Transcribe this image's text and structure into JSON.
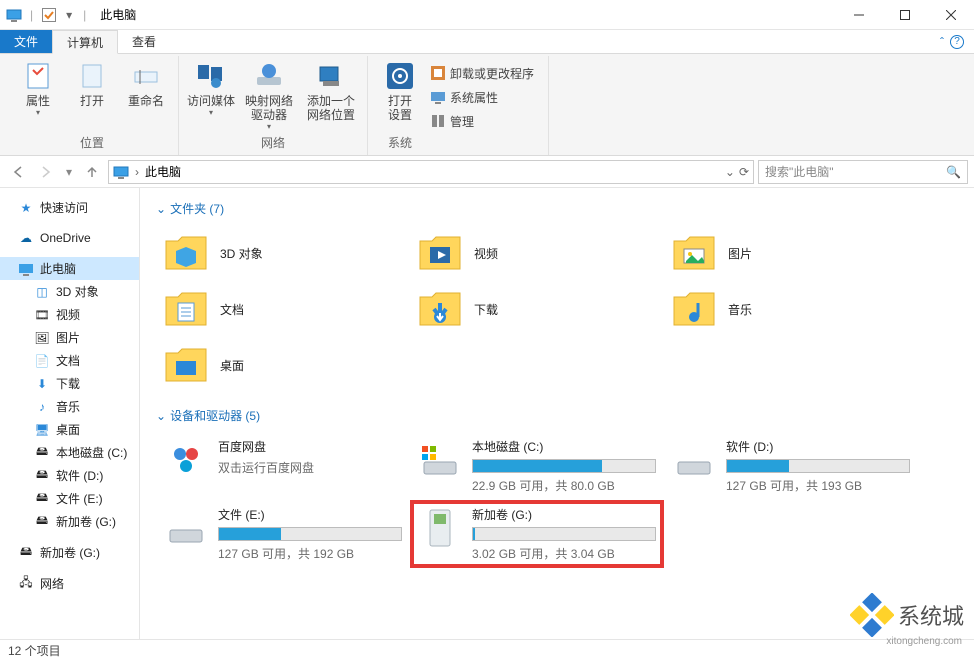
{
  "titlebar": {
    "title": "此电脑",
    "sep": "|"
  },
  "tabs": {
    "file": "文件",
    "computer": "计算机",
    "view": "查看"
  },
  "ribbon": {
    "location": {
      "properties": "属性",
      "open": "打开",
      "rename": "重命名",
      "group": "位置"
    },
    "network": {
      "access_media": "访问媒体",
      "map_drive": "映射网络\n驱动器",
      "add_loc": "添加一个\n网络位置",
      "group": "网络"
    },
    "system": {
      "open_settings": "打开\n设置",
      "uninstall": "卸载或更改程序",
      "sys_props": "系统属性",
      "manage": "管理",
      "group": "系统"
    }
  },
  "address": {
    "path": "此电脑",
    "search_placeholder": "搜索\"此电脑\""
  },
  "sidebar": {
    "quick": "快速访问",
    "onedrive": "OneDrive",
    "thispc": "此电脑",
    "children": [
      {
        "label": "3D 对象"
      },
      {
        "label": "视频"
      },
      {
        "label": "图片"
      },
      {
        "label": "文档"
      },
      {
        "label": "下载"
      },
      {
        "label": "音乐"
      },
      {
        "label": "桌面"
      },
      {
        "label": "本地磁盘 (C:)"
      },
      {
        "label": "软件 (D:)"
      },
      {
        "label": "文件 (E:)"
      },
      {
        "label": "新加卷 (G:)"
      },
      {
        "label": "新加卷 (G:)"
      }
    ],
    "network": "网络"
  },
  "sections": {
    "folders": {
      "head": "文件夹 (7)",
      "items": [
        {
          "label": "3D 对象"
        },
        {
          "label": "视频"
        },
        {
          "label": "图片"
        },
        {
          "label": "文档"
        },
        {
          "label": "下载"
        },
        {
          "label": "音乐"
        },
        {
          "label": "桌面"
        }
      ]
    },
    "drives": {
      "head": "设备和驱动器 (5)",
      "items": [
        {
          "name": "百度网盘",
          "sub": "双击运行百度网盘",
          "bar": null
        },
        {
          "name": "本地磁盘 (C:)",
          "sub": "22.9 GB 可用，共 80.0 GB",
          "bar": 71
        },
        {
          "name": "软件 (D:)",
          "sub": "127 GB 可用，共 193 GB",
          "bar": 34
        },
        {
          "name": "文件 (E:)",
          "sub": "127 GB 可用，共 192 GB",
          "bar": 34
        },
        {
          "name": "新加卷 (G:)",
          "sub": "3.02 GB 可用，共 3.04 GB",
          "bar": 1,
          "highlight": true
        }
      ]
    }
  },
  "status": {
    "items": "12 个项目"
  },
  "watermark": {
    "brand": "系统城",
    "url": "xitongcheng.com"
  }
}
